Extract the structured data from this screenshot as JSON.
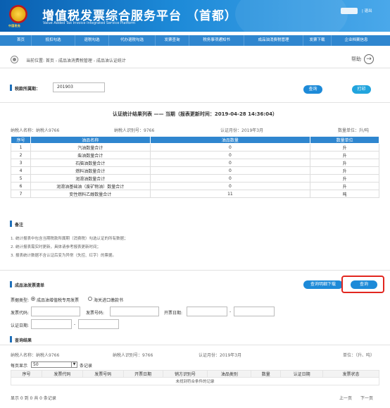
{
  "header": {
    "logo_text": "中国税务",
    "title": "增值税发票综合服务平台 （首都）",
    "subtitle": "Value Added Tax Invoice Integrated Service Platform",
    "logout": "| 退出"
  },
  "nav": [
    "首页",
    "抵扣勾选",
    "退税勾选",
    "代办退税勾选",
    "发票查询",
    "税务事项通知书",
    "成品油消费税管理",
    "发票下载",
    "企业档案信息"
  ],
  "breadcrumb": {
    "text": "当前位置: 首页 - 成品油消费税管理 - 成品油认证统计",
    "help": "帮助"
  },
  "filter": {
    "label": "税款所属期：",
    "value": "201903",
    "query_label": "查询",
    "print_label": "打印"
  },
  "report": {
    "title": "认证统计结果列表 —— 当期（报表更新时间：2019-04-28 14:36:04）",
    "taxpayer_name": "纳税人名称：纳税人9766",
    "taxpayer_id": "纳税人识别号：9766",
    "cert_month": "认证月份：2019年3月",
    "unit": "数量单位：升/吨",
    "columns": [
      "序号",
      "油品名称",
      "油品数量",
      "数量单位"
    ],
    "rows": [
      [
        "1",
        "汽油数量合计",
        "0",
        "升"
      ],
      [
        "2",
        "柴油数量合计",
        "0",
        "升"
      ],
      [
        "3",
        "石脑油数量合计",
        "0",
        "升"
      ],
      [
        "4",
        "燃料油数量合计",
        "0",
        "升"
      ],
      [
        "5",
        "润滑油数量合计",
        "0",
        "升"
      ],
      [
        "6",
        "润滑油基础油（废矿物油）数量合计",
        "0",
        "升"
      ],
      [
        "7",
        "变性燃料乙醇数量合计",
        "11",
        "吨"
      ]
    ]
  },
  "notes": {
    "title": "备注",
    "lines": [
      "1. 统计报表中包含当期税款所属期（消费税）勾选认证的所有数据；",
      "2. 统计报表需实时更新，具体请参考报表更新时间；",
      "3. 报表统计数据不含认证后变为异常（失控、红字）的票据。"
    ]
  },
  "invoices": {
    "title": "成品油发票清单",
    "download_label": "查询明细下载",
    "query_label": "查询",
    "type_label": "票据类型:",
    "type_options": [
      "成品油增值税专用发票",
      "海关进口缴款书"
    ],
    "code_label": "发票代码:",
    "number_label": "发票号码:",
    "date_label": "开票日期:",
    "cert_date_label": "认证日期:",
    "dash": "-"
  },
  "results": {
    "title": "查询结果",
    "taxpayer_name": "纳税人名称：纳税人9766",
    "taxpayer_id": "纳税人识别号：9766",
    "cert_month": "认证月份：2019年3月",
    "unit": "单位：（升、吨）",
    "page_size_prefix": "每页显示",
    "page_size": "50",
    "page_size_suffix": "条记录",
    "columns": [
      "序号",
      "发票代码",
      "发票号码",
      "开票日期",
      "销方识别号",
      "油品类别",
      "数量",
      "认证日期",
      "发票状态"
    ],
    "empty": "未找到符合条件的记录",
    "summary": "显示 0 到 0 共 0 条记录",
    "prev": "上一页",
    "next": "下一页"
  }
}
